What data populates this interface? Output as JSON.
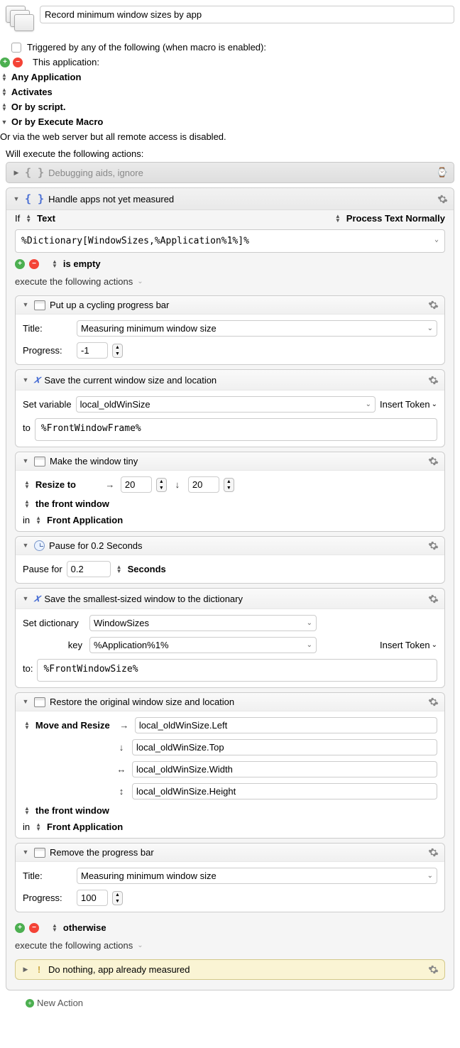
{
  "macro_title": "Record minimum window sizes by app",
  "trigger": {
    "header": "Triggered by any of the following (when macro is enabled):",
    "this_application": "This application:",
    "any_application": "Any Application",
    "activates": "Activates",
    "or_by_script": "Or by script.",
    "or_by_execute_macro": "Or by Execute Macro",
    "or_via_web": "Or via the web server but all remote access is disabled."
  },
  "will_execute": "Will execute the following actions:",
  "group1": {
    "title": "Debugging aids, ignore"
  },
  "group2": {
    "title": "Handle apps not yet measured",
    "if_label": "If",
    "text_label": "Text",
    "process_text": "Process Text Normally",
    "condition_text": "%Dictionary[WindowSizes,%Application%1%]%",
    "is_empty": "is empty",
    "execute_following": "execute the following actions",
    "otherwise": "otherwise",
    "actions": [],
    "else_action": {
      "title": "Do nothing, app already measured"
    }
  },
  "action_progress1": {
    "title": "Put up a cycling progress bar",
    "title_label": "Title:",
    "title_value": "Measuring minimum window size",
    "progress_label": "Progress:",
    "progress_value": "-1"
  },
  "action_save_var": {
    "title": "Save the current window size and location",
    "set_variable_label": "Set variable",
    "variable_name": "local_oldWinSize",
    "insert_token": "Insert Token",
    "to_label": "to",
    "value": "%FrontWindowFrame%"
  },
  "action_tiny": {
    "title": "Make the window tiny",
    "resize_to": "Resize to",
    "w": "20",
    "h": "20",
    "the_front_window": "the front window",
    "in_label": "in",
    "front_application": "Front Application"
  },
  "action_pause": {
    "title": "Pause for 0.2 Seconds",
    "pause_for": "Pause for",
    "value": "0.2",
    "seconds": "Seconds"
  },
  "action_dict": {
    "title": "Save the smallest-sized window to the dictionary",
    "set_dictionary_label": "Set dictionary",
    "dict_name": "WindowSizes",
    "key_label": "key",
    "key_value": "%Application%1%",
    "insert_token": "Insert Token",
    "to_label": "to:",
    "value": "%FrontWindowSize%"
  },
  "action_restore": {
    "title": "Restore the original window size and location",
    "move_and_resize": "Move and Resize",
    "left": "local_oldWinSize.Left",
    "top": "local_oldWinSize.Top",
    "width": "local_oldWinSize.Width",
    "height": "local_oldWinSize.Height",
    "the_front_window": "the front window",
    "in_label": "in",
    "front_application": "Front Application"
  },
  "action_progress2": {
    "title": "Remove the progress bar",
    "title_label": "Title:",
    "title_value": "Measuring minimum window size",
    "progress_label": "Progress:",
    "progress_value": "100"
  },
  "new_action": "New Action"
}
